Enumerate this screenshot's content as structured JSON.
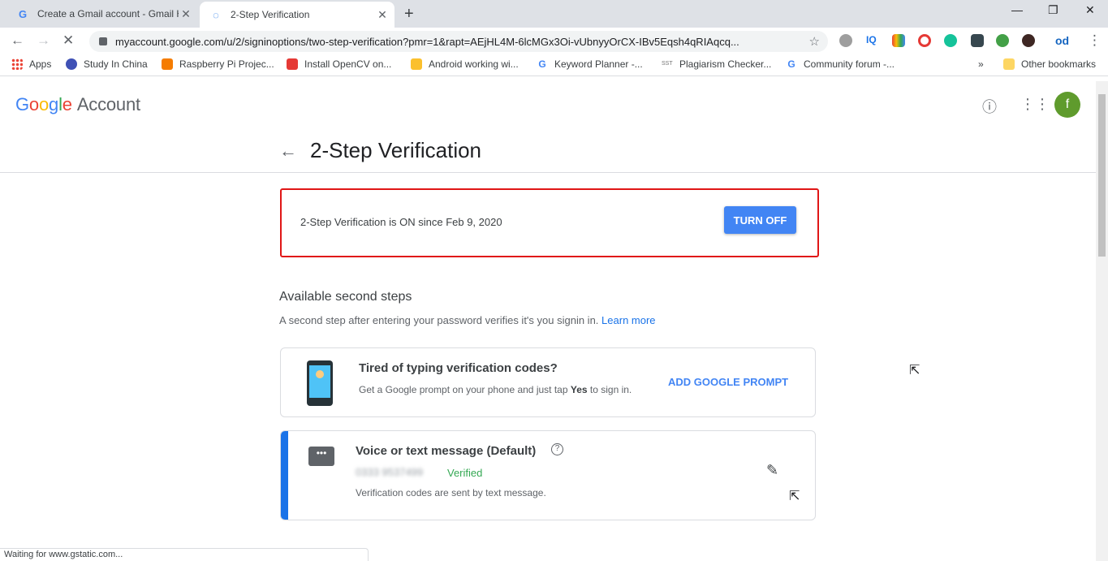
{
  "browser": {
    "tabs": [
      {
        "title": "Create a Gmail account - Gmail H",
        "favicon": "G",
        "close": "✕"
      },
      {
        "title": "2-Step Verification",
        "favicon": "◌",
        "close": "✕"
      }
    ],
    "new_tab": "+",
    "url": "myaccount.google.com/u/2/signinoptions/two-step-verification?pmr=1&rapt=AEjHL4M-6lcMGx3Oi-vUbnyyOrCX-IBv5Eqsh4qRIAqcq...",
    "bookmarks": [
      {
        "label": "Apps",
        "color": "#4285f4"
      },
      {
        "label": "Study In China",
        "color": "#3f51b5"
      },
      {
        "label": "Raspberry Pi Projec...",
        "color": "#f57c00"
      },
      {
        "label": "Install OpenCV on...",
        "color": "#e53935"
      },
      {
        "label": "Android working wi...",
        "color": "#fbc02d"
      },
      {
        "label": "Keyword Planner -...",
        "color": "#4285f4"
      },
      {
        "label": "Plagiarism Checker...",
        "color": "#9e9e9e"
      },
      {
        "label": "Community forum -...",
        "color": "#4285f4"
      }
    ],
    "bookmarks_more": "»",
    "other_bookmarks": "Other bookmarks",
    "status": "Waiting for www.gstatic.com..."
  },
  "header": {
    "logo_google": [
      "G",
      "o",
      "o",
      "g",
      "l",
      "e"
    ],
    "logo_account": "Account",
    "avatar_letter": "f"
  },
  "page": {
    "title": "2-Step Verification",
    "status_text": "2-Step Verification is ON since Feb 9, 2020",
    "turn_off_label": "TURN OFF",
    "section_heading": "Available second steps",
    "section_sub": "A second step after entering your password verifies it's you signin in.",
    "learn_more": "Learn more",
    "prompt_card": {
      "title": "Tired of typing verification codes?",
      "sub_prefix": "Get a Google prompt on your phone and just tap",
      "sub_bold": "Yes",
      "sub_suffix": "to sign in.",
      "action": "ADD GOOGLE PROMPT"
    },
    "sms_card": {
      "title": "Voice or text message (Default)",
      "phone": "0333 9537499",
      "verified": "Verified",
      "sub": "Verification codes are sent by text message."
    }
  },
  "colors": {
    "accent_blue": "#4285f4",
    "highlight_red": "#e01616",
    "verified_green": "#34a853",
    "avatar_green": "#5f9b2d"
  }
}
